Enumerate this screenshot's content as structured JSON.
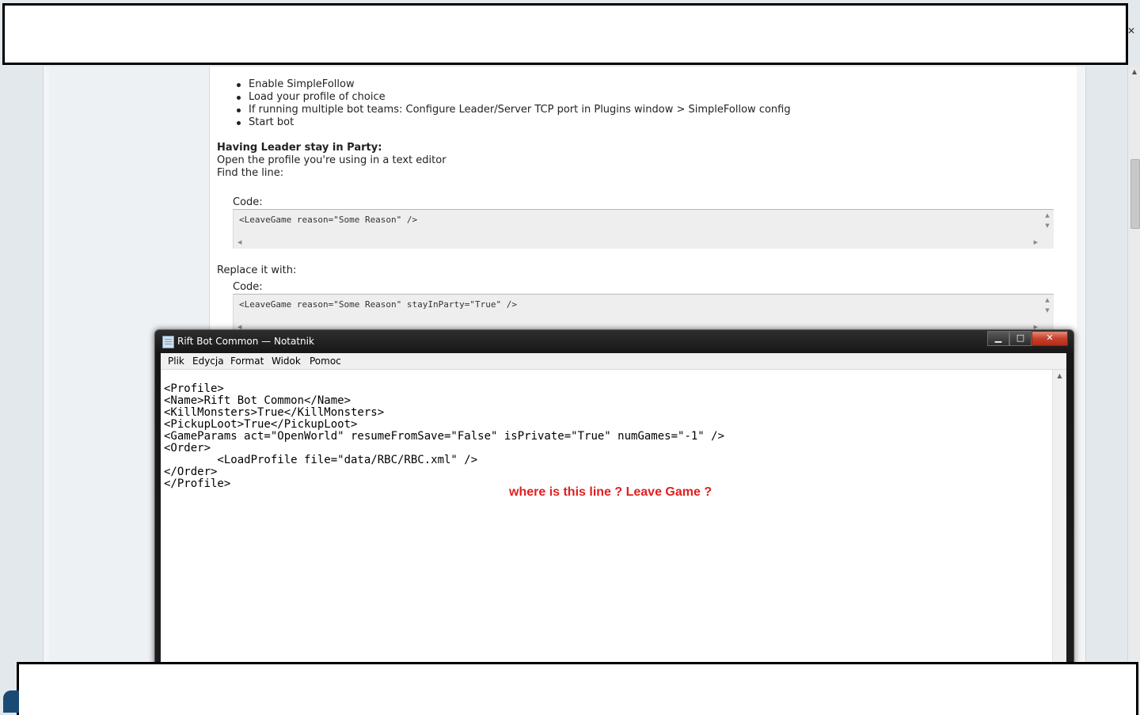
{
  "forum_post": {
    "steps": [
      "Enable SimpleFollow",
      "Load your profile of choice",
      "If running multiple bot teams: Configure Leader/Server TCP port in Plugins window > SimpleFollow config",
      "Start bot"
    ],
    "leader_heading": "Having Leader stay in Party:",
    "open_instruction": "Open the profile you're using in a text editor",
    "find_line": "Find the line:",
    "code_label": "Code:",
    "code1": "<LeaveGame reason=\"Some Reason\" />",
    "replace_label": "Replace it with:",
    "code2": "<LeaveGame reason=\"Some Reason\" stayInParty=\"True\" />"
  },
  "notepad": {
    "title": "Rift Bot Common — Notatnik",
    "menu": [
      "Plik",
      "Edycja",
      "Format",
      "Widok",
      "Pomoc"
    ],
    "lines": [
      "<Profile>",
      "<Name>Rift Bot Common</Name>",
      "<KillMonsters>True</KillMonsters>",
      "<PickupLoot>True</PickupLoot>",
      "<GameParams act=\"OpenWorld\" resumeFromSave=\"False\" isPrivate=\"True\" numGames=\"-1\" />",
      "<Order>",
      "        <LoadProfile file=\"data/RBC/RBC.xml\" />",
      "</Order>",
      "</Profile>"
    ],
    "annotation": "where is this line ? Leave Game ?",
    "annotation_color": "#e02020"
  },
  "window_buttons": {
    "minimize": "▁",
    "maximize": "□",
    "close": "✕"
  },
  "scroll_arrows": {
    "up": "▲",
    "down": "▼",
    "left": "◀",
    "right": "▶"
  }
}
